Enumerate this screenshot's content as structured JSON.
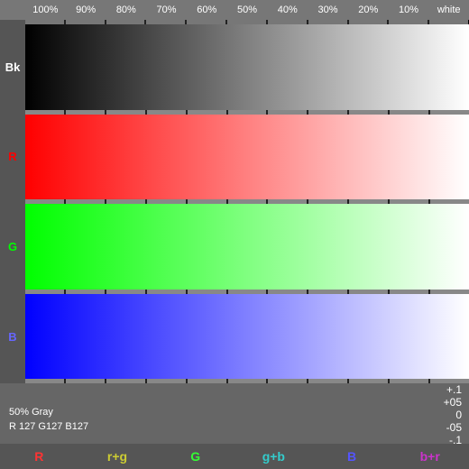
{
  "header": {
    "labels": [
      "100%",
      "90%",
      "80%",
      "70%",
      "60%",
      "50%",
      "40%",
      "30%",
      "20%",
      "10%",
      "white"
    ]
  },
  "rows": [
    {
      "id": "bk",
      "label": "Bk",
      "color": "black"
    },
    {
      "id": "r",
      "label": "R",
      "color": "red"
    },
    {
      "id": "g",
      "label": "G",
      "color": "green"
    },
    {
      "id": "b",
      "label": "B",
      "color": "blue"
    }
  ],
  "gray_info": {
    "line1": "50% Gray",
    "line2": "R 127 G127 B127"
  },
  "scale": {
    "values": [
      "+.1",
      "+05",
      "0",
      "-05",
      "-.1"
    ]
  },
  "channels": [
    {
      "label": "R",
      "color": "#ff3333"
    },
    {
      "label": "r+g",
      "color": "#cccc33"
    },
    {
      "label": "G",
      "color": "#33ff33"
    },
    {
      "label": "g+b",
      "color": "#33cccc"
    },
    {
      "label": "B",
      "color": "#3333ff"
    },
    {
      "label": "b+r",
      "color": "#cc33cc"
    }
  ]
}
